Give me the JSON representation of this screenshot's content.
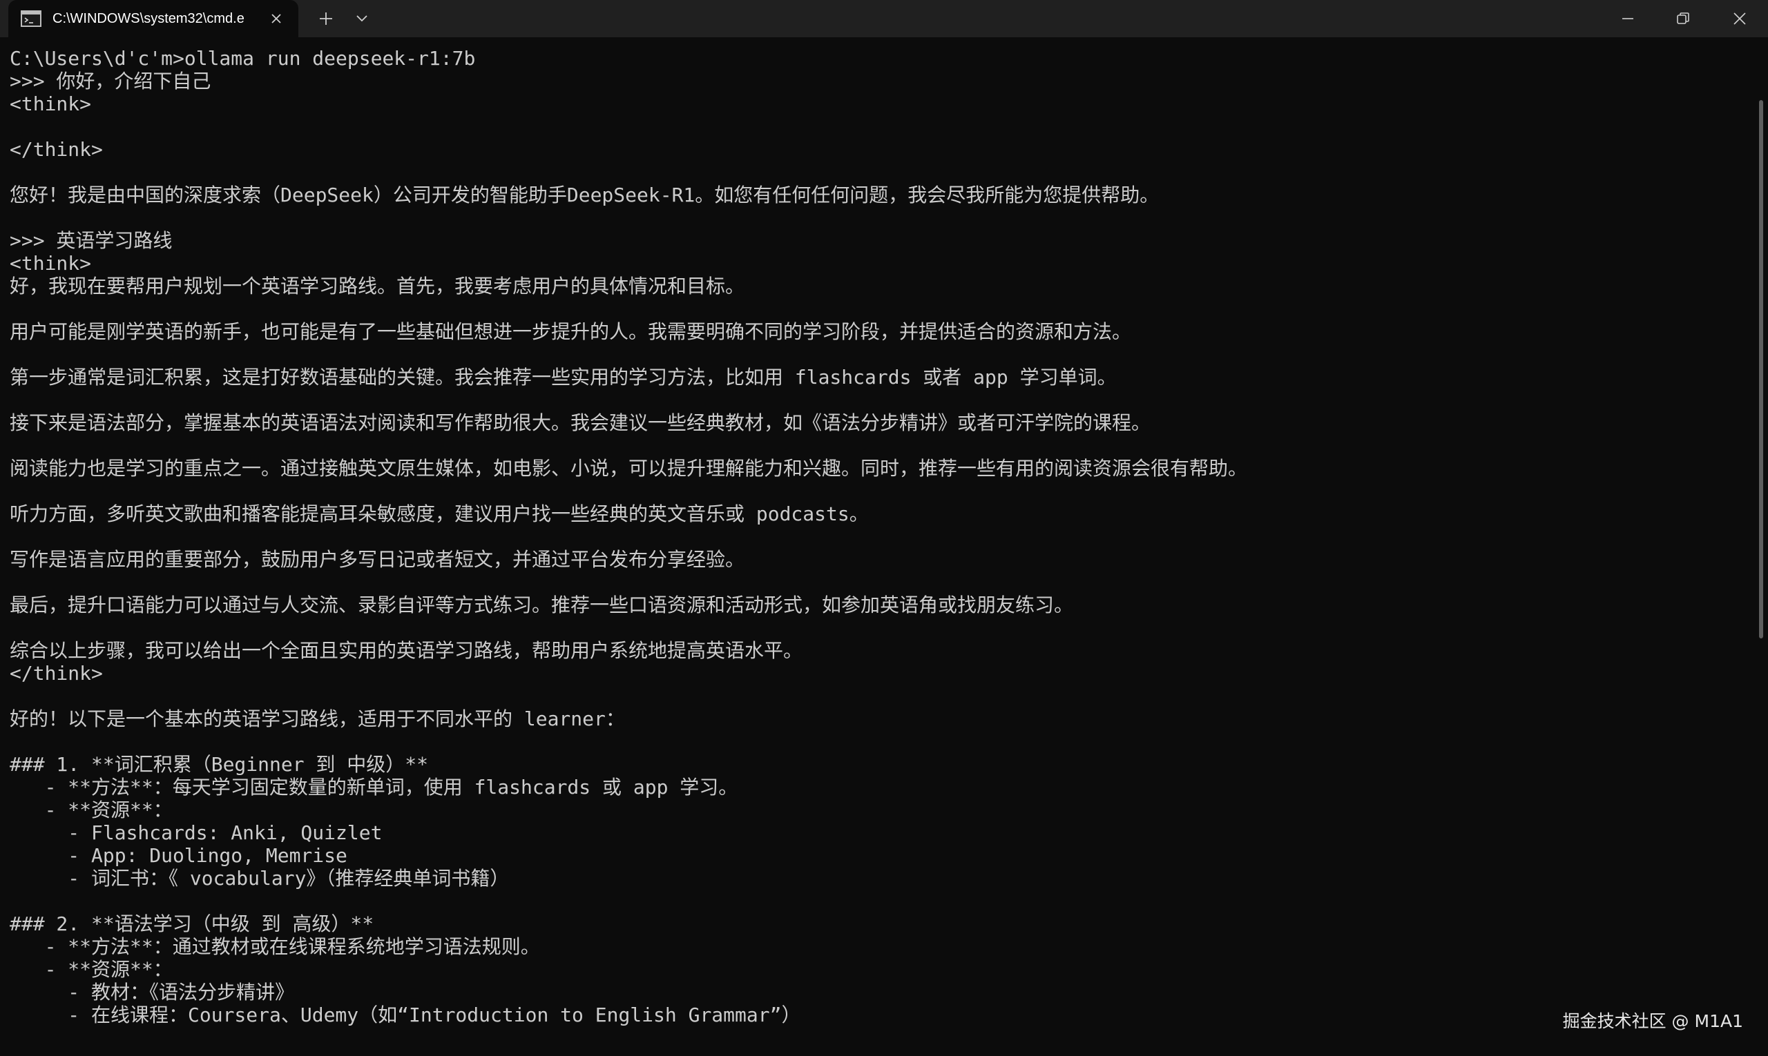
{
  "window": {
    "tab_title": "C:\\WINDOWS\\system32\\cmd.e"
  },
  "console": {
    "lines": [
      "C:\\Users\\d'c'm>ollama run deepseek-r1:7b",
      ">>> 你好，介绍下自己",
      "<think>",
      "",
      "</think>",
      "",
      "您好！我是由中国的深度求索（DeepSeek）公司开发的智能助手DeepSeek-R1。如您有任何任何问题，我会尽我所能为您提供帮助。",
      "",
      ">>> 英语学习路线",
      "<think>",
      "好，我现在要帮用户规划一个英语学习路线。首先，我要考虑用户的具体情况和目标。",
      "",
      "用户可能是刚学英语的新手，也可能是有了一些基础但想进一步提升的人。我需要明确不同的学习阶段，并提供适合的资源和方法。",
      "",
      "第一步通常是词汇积累，这是打好数语基础的关键。我会推荐一些实用的学习方法，比如用 flashcards 或者 app 学习单词。",
      "",
      "接下来是语法部分，掌握基本的英语语法对阅读和写作帮助很大。我会建议一些经典教材，如《语法分步精讲》或者可汗学院的课程。",
      "",
      "阅读能力也是学习的重点之一。通过接触英文原生媒体，如电影、小说，可以提升理解能力和兴趣。同时，推荐一些有用的阅读资源会很有帮助。",
      "",
      "听力方面，多听英文歌曲和播客能提高耳朵敏感度，建议用户找一些经典的英文音乐或 podcasts。",
      "",
      "写作是语言应用的重要部分，鼓励用户多写日记或者短文，并通过平台发布分享经验。",
      "",
      "最后，提升口语能力可以通过与人交流、录影自评等方式练习。推荐一些口语资源和活动形式，如参加英语角或找朋友练习。",
      "",
      "综合以上步骤，我可以给出一个全面且实用的英语学习路线，帮助用户系统地提高英语水平。",
      "</think>",
      "",
      "好的！以下是一个基本的英语学习路线，适用于不同水平的 learner：",
      "",
      "### 1. **词汇积累（Beginner 到 中级）**",
      "   - **方法**：每天学习固定数量的新单词，使用 flashcards 或 app 学习。",
      "   - **资源**：",
      "     - Flashcards: Anki, Quizlet",
      "     - App: Duolingo, Memrise",
      "     - 词汇书：《 vocabulary》（推荐经典单词书籍）",
      "",
      "### 2. **语法学习（中级 到 高级）**",
      "   - **方法**：通过教材或在线课程系统地学习语法规则。",
      "   - **资源**：",
      "     - 教材：《语法分步精讲》",
      "     - 在线课程：Coursera、Udemy（如“Introduction to English Grammar”）"
    ]
  },
  "watermark": "掘金技术社区 @ M1A1"
}
